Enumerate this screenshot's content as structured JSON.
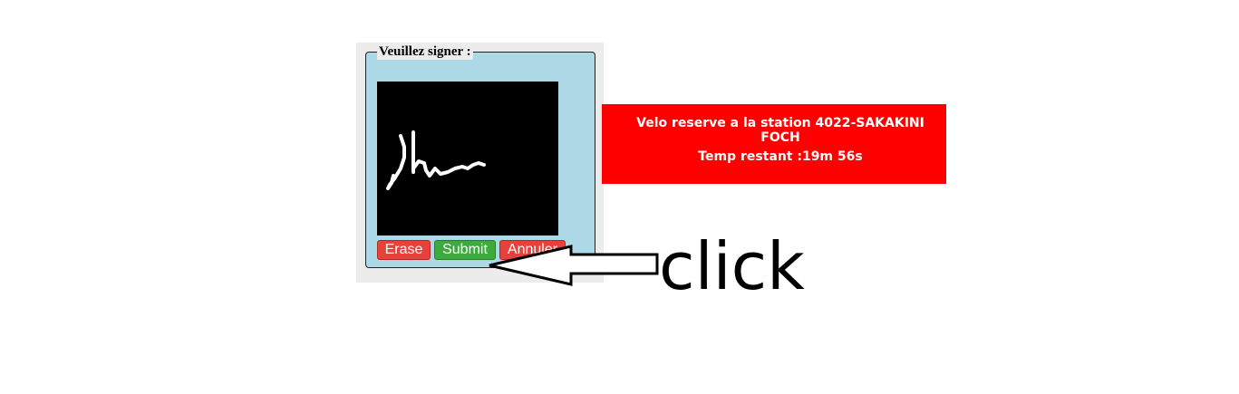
{
  "signature": {
    "legend": "Veuillez signer :",
    "buttons": {
      "erase": "Erase",
      "submit": "Submit",
      "cancel": "Annuler"
    },
    "colors": {
      "panel": "#add8e6",
      "canvas": "#000000",
      "erase": "#e8403a",
      "submit": "#3daa3d",
      "cancel": "#e8403a"
    }
  },
  "reservation": {
    "message": "Velo reserve a la station 4022-SAKAKINI FOCH",
    "timer": "Temp restant :19m 56s",
    "color": "#ff0000"
  },
  "annotation": {
    "text": "click",
    "arrow_icon": "left-arrow-icon"
  }
}
